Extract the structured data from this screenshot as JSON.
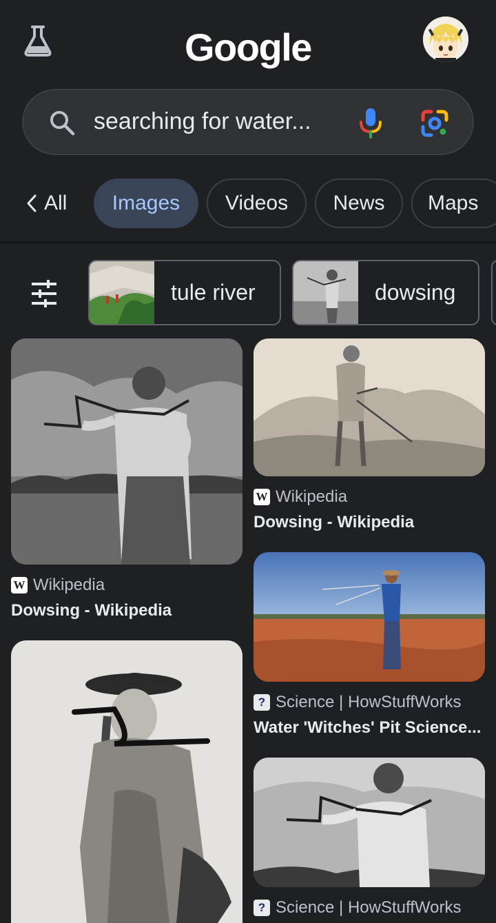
{
  "header": {
    "logo_text": "Google",
    "labs_icon": "flask-icon",
    "avatar_icon": "avatar"
  },
  "search": {
    "query": "searching for water...",
    "search_icon": "search-icon",
    "mic_icon": "mic-icon",
    "lens_icon": "lens-icon"
  },
  "tabs": {
    "back_label": "All",
    "items": [
      {
        "label": "Images",
        "active": true
      },
      {
        "label": "Videos",
        "active": false
      },
      {
        "label": "News",
        "active": false
      },
      {
        "label": "Maps",
        "active": false
      }
    ]
  },
  "filters": {
    "tune_icon": "tune-icon",
    "chips": [
      {
        "label": "tule river"
      },
      {
        "label": "dowsing"
      }
    ]
  },
  "results": [
    {
      "source": "Wikipedia",
      "favicon": "wikipedia-icon",
      "title": "Dowsing - Wikipedia"
    },
    {
      "source": "Wikipedia",
      "favicon": "wikipedia-icon",
      "title": "Dowsing - Wikipedia"
    },
    {
      "source": "Science | HowStuffWorks",
      "favicon": "howstuffworks-icon",
      "title": "Water 'Witches' Pit Science..."
    },
    {
      "source": "",
      "favicon": "",
      "title": ""
    },
    {
      "source": "Science | HowStuffWorks",
      "favicon": "howstuffworks-icon",
      "title": ""
    }
  ],
  "colors": {
    "background": "#1f2023",
    "search_bg": "#303134",
    "active_tab_bg": "#394457",
    "active_tab_text": "#a8c7fa",
    "text": "#e8eaed"
  }
}
